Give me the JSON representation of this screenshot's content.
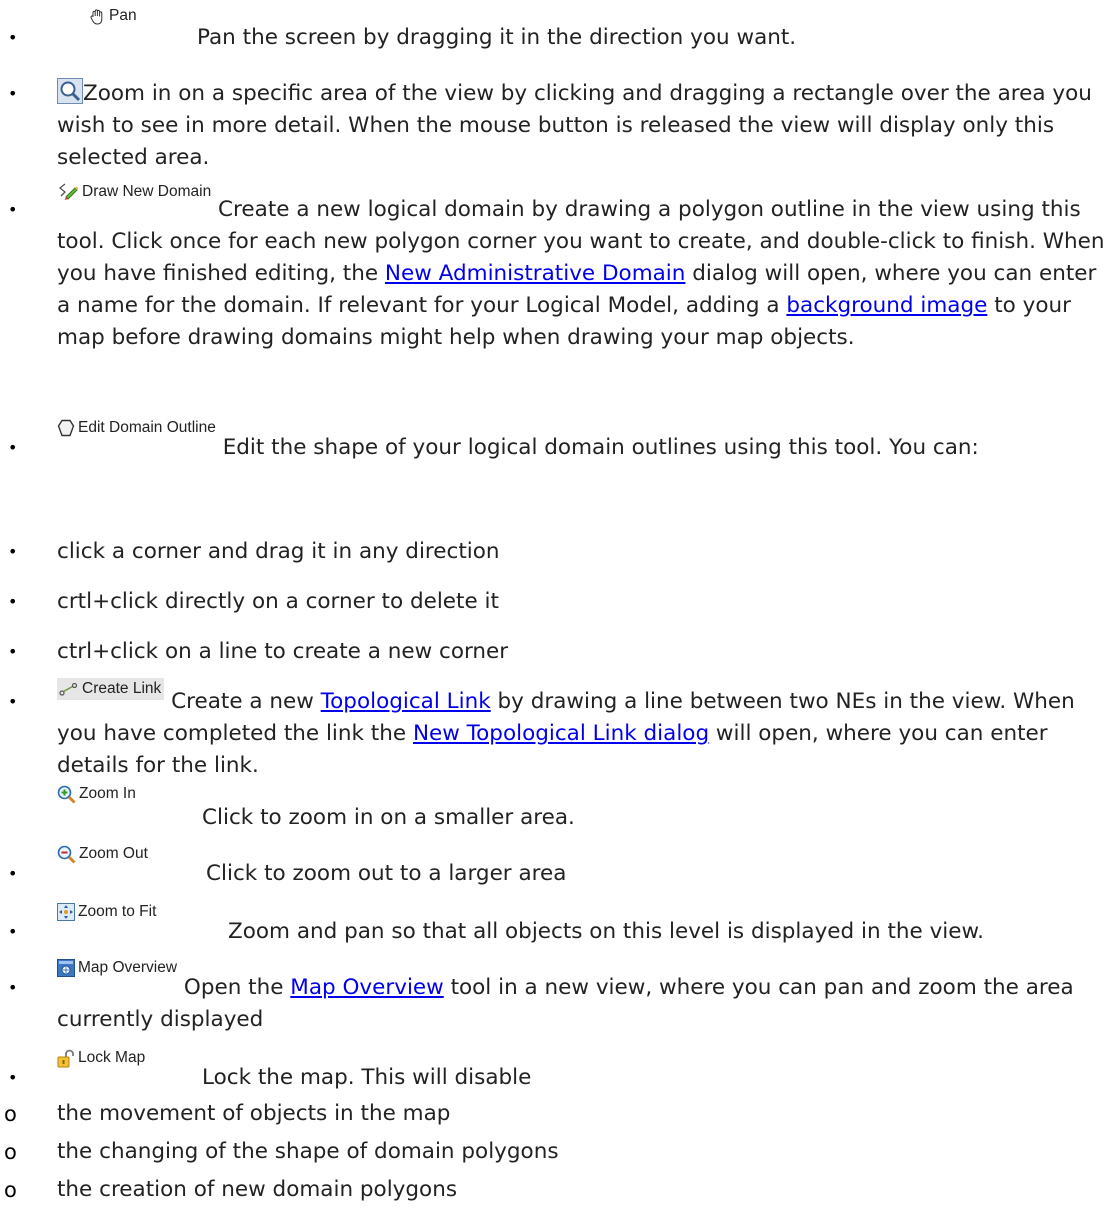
{
  "items": [
    {
      "button": "Pan",
      "text": "Pan the screen by dragging it in the direction you want."
    },
    {
      "text": "Zoom in on a specific area of the view by clicking and dragging a rectangle over the area you wish to see in more detail. When the mouse button is released the view will display only this selected area."
    },
    {
      "button": "Draw New Domain",
      "text_a": "Create a new logical domain by drawing a polygon outline in the view using this tool. Click once for each new polygon corner you want to create, and double-click to finish. When you have finished editing, the ",
      "link_a": "New Administrative Domain",
      "text_b": " dialog will open, where you can enter a name for the domain. If relevant for your Logical Model, adding a ",
      "link_b": "background image",
      "text_c": " to your map before drawing domains might help when drawing your map objects."
    },
    {
      "button": "Edit Domain Outline",
      "text": "Edit the shape of your logical domain outlines using this tool. You can:"
    },
    {
      "text": "click a corner and drag it in any direction"
    },
    {
      "text": "crtl+click directly on a corner to delete it"
    },
    {
      "text": "ctrl+click on a line to create a new corner"
    },
    {
      "button": "Create Link",
      "text_a": "Create a new ",
      "link_a": "Topological Link",
      "text_b": " by drawing a line between two NEs in the view. When you have completed the link the ",
      "link_b": "New Topological Link dialog",
      "text_c": " will open, where you can enter details for the link."
    },
    {
      "button": "Zoom In",
      "text": "Click to zoom in on a smaller area."
    },
    {
      "button": "Zoom Out",
      "text": "Click to zoom out to a larger area"
    },
    {
      "button": "Zoom to Fit",
      "text": "Zoom and pan so that all objects on this level is displayed in the view."
    },
    {
      "button": "Map Overview",
      "text_a": "Open the ",
      "link_a": "Map Overview",
      "text_b": " tool in a new view, where you can pan and zoom the area currently displayed"
    },
    {
      "button": "Lock Map",
      "text": "Lock the map. This will disable"
    }
  ],
  "sub_items": [
    {
      "text": "the movement of objects in the map"
    },
    {
      "text": "the changing of the shape of domain polygons"
    },
    {
      "text": "the creation of new domain polygons"
    }
  ],
  "markers": {
    "bullet": "•",
    "sub_bullet": "o"
  },
  "colors": {
    "link": "#0000ee",
    "text": "#222222",
    "background": "#ffffff"
  }
}
